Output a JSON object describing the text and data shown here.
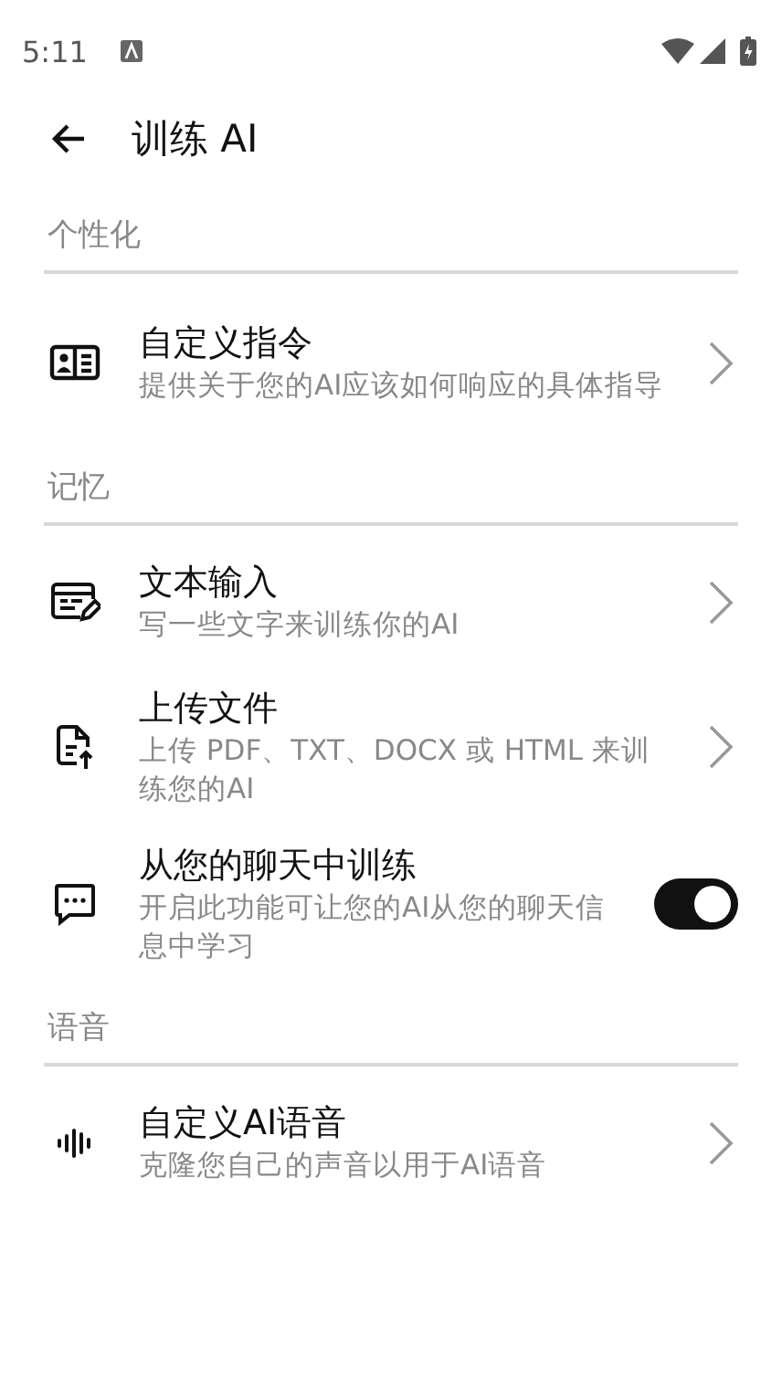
{
  "status_bar": {
    "time": "5:11"
  },
  "header": {
    "title": "训练 AI"
  },
  "sections": [
    {
      "title": "个性化",
      "items": [
        {
          "kind": "link",
          "title": "自定义指令",
          "subtitle": "提供关于您的AI应该如何响应的具体指导"
        }
      ]
    },
    {
      "title": "记忆",
      "items": [
        {
          "kind": "link",
          "title": "文本输入",
          "subtitle": "写一些文字来训练你的AI"
        },
        {
          "kind": "link",
          "title": "上传文件",
          "subtitle": "上传 PDF、TXT、DOCX 或 HTML 来训练您的AI"
        },
        {
          "kind": "toggle",
          "title": "从您的聊天中训练",
          "subtitle": "开启此功能可让您的AI从您的聊天信息中学习",
          "on": true
        }
      ]
    },
    {
      "title": "语音",
      "items": [
        {
          "kind": "link",
          "title": "自定义AI语音",
          "subtitle": "克隆您自己的声音以用于AI语音"
        }
      ]
    }
  ]
}
